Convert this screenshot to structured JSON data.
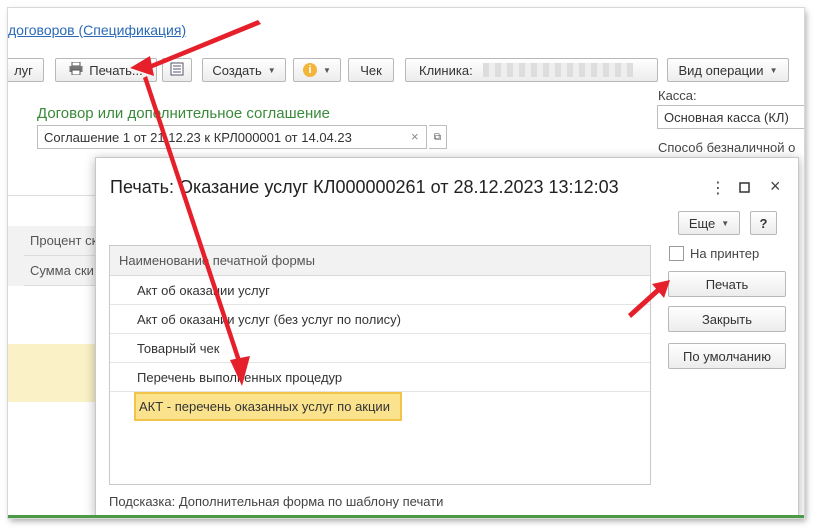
{
  "header": {
    "title_link": "договоров (Спецификация)"
  },
  "toolbar": {
    "services_btn": "луг",
    "print_btn": "Печать...",
    "create_btn": "Создать",
    "check_btn": "Чек",
    "clinic_label": "Клиника:",
    "operation_btn": "Вид операции"
  },
  "contract": {
    "label": "Договор или дополнительное соглашение",
    "value": "Соглашение 1 от 21.12.23 к КРЛ000001 от 14.04.23"
  },
  "right_panel": {
    "cash_label": "Касса:",
    "cash_value": "Основная касса (КЛ)",
    "payment_label": "Способ безналичной о"
  },
  "grid": {
    "percent_header": "Процент ск",
    "sum_header": "Сумма ски"
  },
  "dialog": {
    "title": "Печать: Оказание услуг КЛ000000261 от 28.12.2023 13:12:03",
    "more_btn": "Еще",
    "help_btn": "?",
    "list_header": "Наименование печатной формы",
    "items": [
      "Акт об оказании услуг",
      "Акт об оказании услуг (без услуг по полису)",
      "Товарный чек",
      "Перечень выполненных процедур",
      "АКТ - перечень оказанных услуг по акции"
    ],
    "to_printer_label": "На принтер",
    "print_btn": "Печать",
    "close_btn": "Закрыть",
    "default_btn": "По умолчанию",
    "hint": "Подсказка: Дополнительная форма по шаблону печати"
  },
  "colors": {
    "accent_red": "#e5202a",
    "selection": "#fbe38e",
    "link": "#2a6ab5",
    "green": "#3a8a3a"
  }
}
